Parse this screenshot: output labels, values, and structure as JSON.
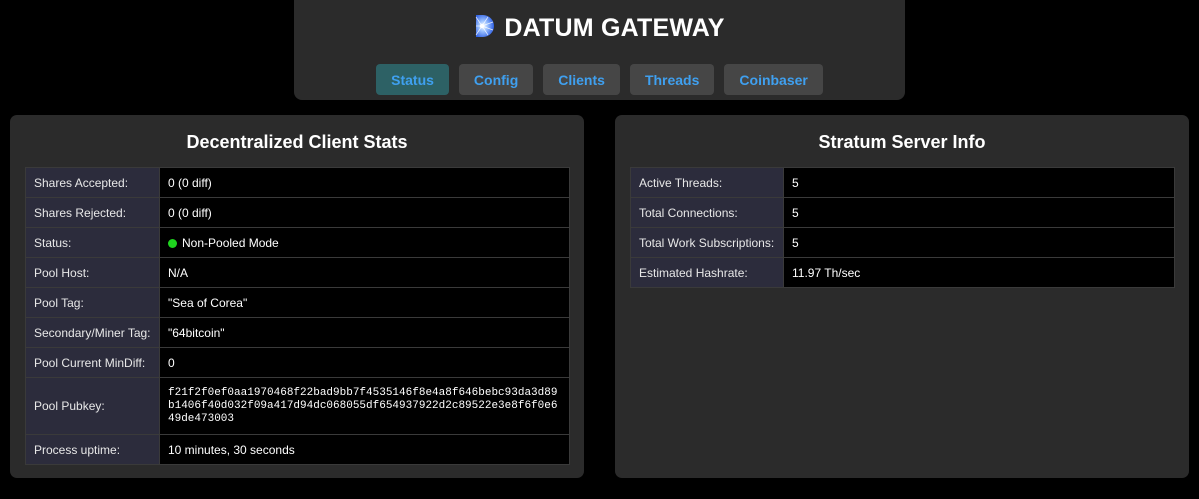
{
  "header": {
    "title": "DATUM GATEWAY",
    "logo_icon": "datum-logo-icon",
    "tabs": [
      {
        "label": "Status",
        "active": true
      },
      {
        "label": "Config",
        "active": false
      },
      {
        "label": "Clients",
        "active": false
      },
      {
        "label": "Threads",
        "active": false
      },
      {
        "label": "Coinbaser",
        "active": false
      }
    ]
  },
  "client_stats": {
    "title": "Decentralized Client Stats",
    "rows": [
      {
        "label": "Shares Accepted:",
        "value": "0 (0 diff)"
      },
      {
        "label": "Shares Rejected:",
        "value": "0 (0 diff)"
      },
      {
        "label": "Status:",
        "value": "Non-Pooled Mode",
        "status_color": "#1fd41f"
      },
      {
        "label": "Pool Host:",
        "value": "N/A"
      },
      {
        "label": "Pool Tag:",
        "value": "\"Sea of Corea\""
      },
      {
        "label": "Secondary/Miner Tag:",
        "value": "\"64bitcoin\""
      },
      {
        "label": "Pool Current MinDiff:",
        "value": "0"
      },
      {
        "label": "Pool Pubkey:",
        "value": "f21f2f0ef0aa1970468f22bad9bb7f4535146f8e4a8f646bebc93da3d89b1406f40d032f09a417d94dc068055df654937922d2c89522e3e8f6f0e649de473003"
      },
      {
        "label": "Process uptime:",
        "value": "10 minutes, 30 seconds"
      }
    ]
  },
  "stratum_info": {
    "title": "Stratum Server Info",
    "rows": [
      {
        "label": "Active Threads:",
        "value": "5"
      },
      {
        "label": "Total Connections:",
        "value": "5"
      },
      {
        "label": "Total Work Subscriptions:",
        "value": "5"
      },
      {
        "label": "Estimated Hashrate:",
        "value": "11.97 Th/sec"
      }
    ]
  },
  "colors": {
    "background": "#000000",
    "panel": "#2b2b2b",
    "tab_text": "#3fa0f0",
    "tab_active": "#2d6165",
    "status_ok": "#1fd41f"
  }
}
